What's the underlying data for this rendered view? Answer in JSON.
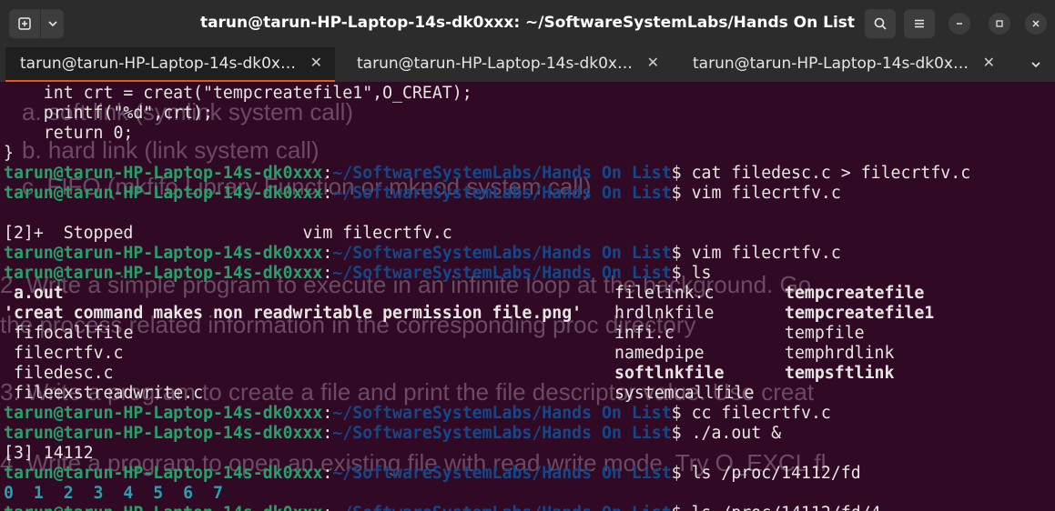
{
  "window": {
    "title": "tarun@tarun-HP-Laptop-14s-dk0xxx: ~/SoftwareSystemLabs/Hands On List"
  },
  "tabs": [
    {
      "label": "tarun@tarun-HP-Laptop-14s-dk0x…",
      "close": "✕",
      "active": true
    },
    {
      "label": "tarun@tarun-HP-Laptop-14s-dk0x…",
      "close": "✕",
      "active": false
    },
    {
      "label": "tarun@tarun-HP-Laptop-14s-dk0x…",
      "close": "✕",
      "active": false
    }
  ],
  "prompt": {
    "user": "tarun@tarun-HP-Laptop-14s-dk0xxx",
    "sep": ":",
    "path": "~/SoftwareSystemLabs/Hands On List",
    "sigil": "$ "
  },
  "code": [
    "    int crt = creat(\"tempcreatefile1\",O_CREAT);",
    "    printf(\"%d\",crt);",
    "    return 0;",
    "}"
  ],
  "commands": [
    "cat filedesc.c > filecrtfv.c",
    "vim filecrtfv.c",
    "vim filecrtfv.c",
    "ls",
    "cc filecrtfv.c",
    "./a.out &",
    "ls /proc/14112/fd",
    "ls /proc/14112/fd/4"
  ],
  "job_stopped": "[2]+  Stopped                 vim filecrtfv.c",
  "job_started": "[3] 14112",
  "fd_list": "0  1  2  3  4  5  6  7",
  "ls_output": {
    "col1": [
      {
        "name": "a.out",
        "color": "#26a269"
      },
      {
        "name": "'creat command makes non readwritable permission file.png'",
        "color": "#a347ba"
      },
      {
        "name": "fifocallfile",
        "color": "#a2734c"
      },
      {
        "name": "filecrtfv.c",
        "color": "#e8e6e3"
      },
      {
        "name": "filedesc.c",
        "color": "#e8e6e3"
      },
      {
        "name": "fileexstreadwrite.c",
        "color": "#e8e6e3"
      }
    ],
    "col2": [
      {
        "name": "filelink.c",
        "color": "#e8e6e3"
      },
      {
        "name": "hrdlnkfile",
        "color": "#e8e6e3"
      },
      {
        "name": "infi.c",
        "color": "#e8e6e3"
      },
      {
        "name": "namedpipe",
        "color": "#a2734c"
      },
      {
        "name": "softlnkfile",
        "color": "#2aa1b3"
      },
      {
        "name": "systemcallfile",
        "color": "#e8e6e3"
      }
    ],
    "col3": [
      {
        "name": "tempcreatefile",
        "color": "#26a269"
      },
      {
        "name": "tempcreatefile1",
        "color": "#26a269"
      },
      {
        "name": "tempfile",
        "color": "#e8e6e3"
      },
      {
        "name": "temphrdlink",
        "color": "#e8e6e3"
      },
      {
        "name": "tempsftlink",
        "color": "#2aa1b3"
      }
    ]
  },
  "background_slide": [
    "a. soft link (symlink system call)",
    "b. hard link (link system call)",
    "c. FIFO (mkfifo Library Function or mknod system call)",
    "2. Write a simple program to execute in an infinite loop at the background. Go",
    "   the process related information in the corresponding proc directory",
    "3. Write a program to create a file and print the file descriptor value. Use creat",
    "4. Write a program to open an existing file with read write mode. Try O_EXCL fl"
  ],
  "colors": {
    "terminal_bg": "#300a24",
    "prompt_user": "#26a269",
    "prompt_path": "#12488b",
    "accent": "#e95420"
  }
}
